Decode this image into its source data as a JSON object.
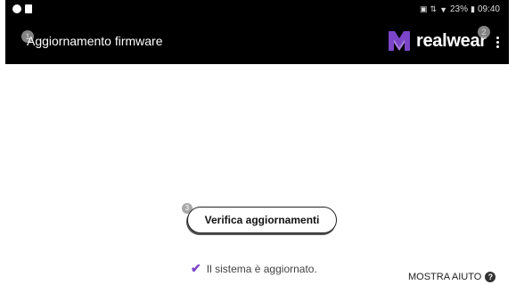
{
  "status_bar": {
    "battery": "23%",
    "time": "09:40"
  },
  "app_bar": {
    "title": "Aggiornamento firmware",
    "logo_text": "realwear"
  },
  "markers": [
    "1",
    "2",
    "3"
  ],
  "main": {
    "check_button_label": "Verifica aggiornamenti",
    "status_text": "Il sistema è aggiornato."
  },
  "help": {
    "label": "MOSTRA AIUTO"
  },
  "icons": {
    "check": "check-icon",
    "help": "help-icon",
    "menu": "more-vert-icon"
  },
  "colors": {
    "app_bar_bg": "#000000",
    "check_color": "#7b45c9",
    "logo_purple": "#7b45c9"
  }
}
